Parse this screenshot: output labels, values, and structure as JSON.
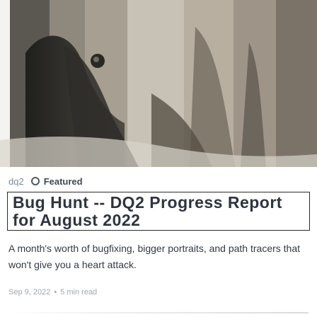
{
  "post": {
    "tag": "dq2",
    "featured_label": "Featured",
    "title": "Bug Hunt -- DQ2 Progress Report for August 2022",
    "excerpt": "A month's worth of bugfixing, bigger portraits, and path tracers that won't give you a heart attack.",
    "date": "Sep 9, 2022",
    "separator": "•",
    "read_time": "5 min read"
  },
  "icons": {
    "featured": "featured-icon"
  }
}
